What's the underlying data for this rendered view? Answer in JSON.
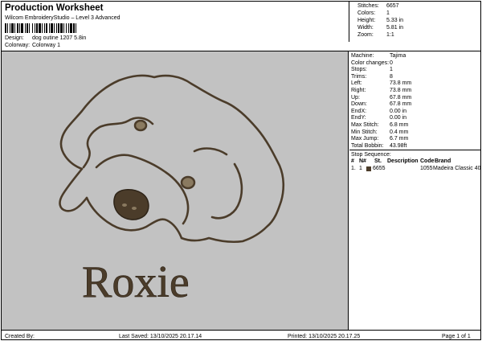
{
  "header": {
    "title": "Production Worksheet",
    "subtitle": "Wilcom EmbroideryStudio – Level 3 Advanced",
    "design_label": "Design:",
    "design_value": "dog outine 1207 5.8in",
    "colorway_label": "Colorway:",
    "colorway_value": "Colorway 1"
  },
  "stats": [
    {
      "label": "Stitches:",
      "value": "6657"
    },
    {
      "label": "Colors:",
      "value": "1"
    },
    {
      "label": "Height:",
      "value": "5.33 in"
    },
    {
      "label": "Width:",
      "value": "5.81 in"
    },
    {
      "label": "Zoom:",
      "value": "1:1"
    }
  ],
  "details": [
    {
      "label": "Machine:",
      "value": "Tajima"
    },
    {
      "label": "Color changes:",
      "value": "0"
    },
    {
      "label": "Stops:",
      "value": "1"
    },
    {
      "label": "Trims:",
      "value": "8"
    },
    {
      "label": "Left:",
      "value": "73.8 mm"
    },
    {
      "label": "Right:",
      "value": "73.8 mm"
    },
    {
      "label": "Up:",
      "value": "67.8 mm"
    },
    {
      "label": "Down:",
      "value": "67.8 mm"
    },
    {
      "label": "EndX:",
      "value": "0.00 in"
    },
    {
      "label": "EndY:",
      "value": "0.00 in"
    },
    {
      "label": "Max Stitch:",
      "value": "6.8 mm"
    },
    {
      "label": "Min Stitch:",
      "value": "0.4 mm"
    },
    {
      "label": "Max Jump:",
      "value": "6.7 mm"
    },
    {
      "label": "Total Bobbin:",
      "value": "43.98ft"
    }
  ],
  "stop_sequence": {
    "title": "Stop Sequence:",
    "headers": {
      "num": "#",
      "n": "N#",
      "st": "St.",
      "description": "Description",
      "code": "Code",
      "brand": "Brand"
    },
    "rows": [
      {
        "num": "1.",
        "n": "1",
        "st": "6655",
        "description": "",
        "code": "1055",
        "brand": "Madeira Classic 40",
        "color": "#4b3c2a"
      }
    ]
  },
  "design": {
    "lettering": "Roxie",
    "thread_color": "#4b3c2a"
  },
  "footer": {
    "created_by": "Created By:",
    "last_saved": "Last Saved: 13/10/2025 20.17.14",
    "printed": "Printed: 13/10/2025 20.17.25",
    "page": "Page 1 of 1"
  }
}
